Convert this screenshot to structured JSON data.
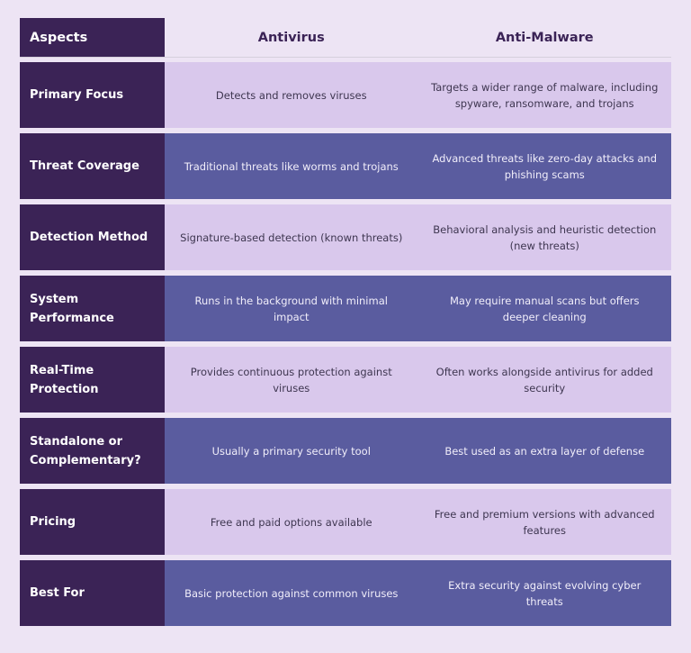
{
  "table": {
    "headers": {
      "aspects": "Aspects",
      "antivirus": "Antivirus",
      "anti_malware": "Anti-Malware"
    },
    "rows": [
      {
        "aspect": "Primary Focus",
        "antivirus": "Detects and removes viruses",
        "anti_malware": "Targets a wider range of malware, including spyware, ransomware, and trojans"
      },
      {
        "aspect": "Threat Coverage",
        "antivirus": "Traditional threats like worms and trojans",
        "anti_malware": "Advanced threats like zero-day attacks and phishing scams"
      },
      {
        "aspect": "Detection Method",
        "antivirus": "Signature-based detection (known threats)",
        "anti_malware": "Behavioral analysis and heuristic detection (new threats)"
      },
      {
        "aspect": "System Performance",
        "antivirus": "Runs in the background with minimal impact",
        "anti_malware": "May require manual scans but offers deeper cleaning"
      },
      {
        "aspect": "Real-Time Protection",
        "antivirus": "Provides continuous protection against viruses",
        "anti_malware": "Often works alongside antivirus for added security"
      },
      {
        "aspect": "Standalone or Complementary?",
        "antivirus": "Usually a primary security tool",
        "anti_malware": "Best used as an extra layer of defense"
      },
      {
        "aspect": "Pricing",
        "antivirus": "Free and paid options available",
        "anti_malware": "Free and premium versions with advanced features"
      },
      {
        "aspect": "Best For",
        "antivirus": "Basic protection against common viruses",
        "anti_malware": "Extra security against evolving cyber threats"
      }
    ]
  },
  "colors": {
    "background": "#ede4f4",
    "aspect_column": "#3b2356",
    "row_light": "#d9c8ec",
    "row_dark": "#5a5c9f"
  }
}
